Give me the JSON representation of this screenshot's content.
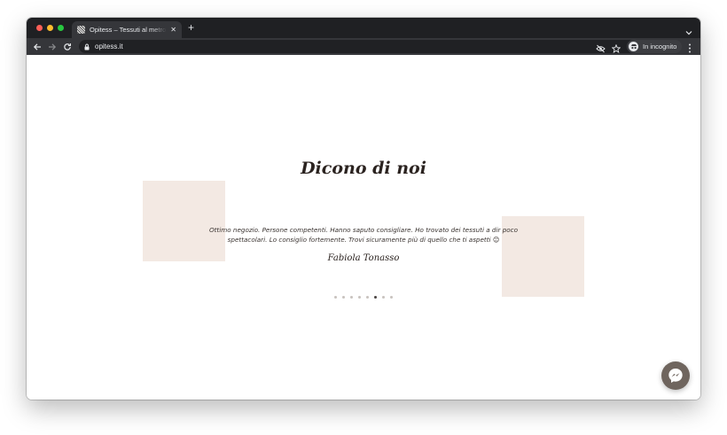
{
  "browser": {
    "tab_title": "Opitess – Tessuti al metro e biancheria",
    "tab_close": "✕",
    "new_tab": "+",
    "url": "opitess.it",
    "incognito_label": "In incognito"
  },
  "page": {
    "heading": "Dicono di noi",
    "testimonial": {
      "quote": "Ottimo negozio. Persone competenti. Hanno saputo consigliare. Ho trovato dei tessuti a dir poco spettacolari. Lo consiglio fortemente. Trovi sicuramente più di quello che ti aspetti 😊",
      "author": "Fabiola Tonasso"
    },
    "carousel": {
      "slide_count": 8,
      "active_index": 5
    }
  },
  "colors": {
    "accent_beige": "#f3e9e3",
    "messenger_bg": "#6f655e",
    "browser_dark": "#1f2023"
  },
  "icons": {
    "back": "arrow-left-icon",
    "forward": "arrow-right-icon",
    "reload": "reload-icon",
    "lock": "lock-icon",
    "eye_off": "eye-off-icon",
    "star": "star-icon",
    "incognito": "incognito-icon",
    "menu": "kebab-menu-icon",
    "messenger": "messenger-icon"
  }
}
